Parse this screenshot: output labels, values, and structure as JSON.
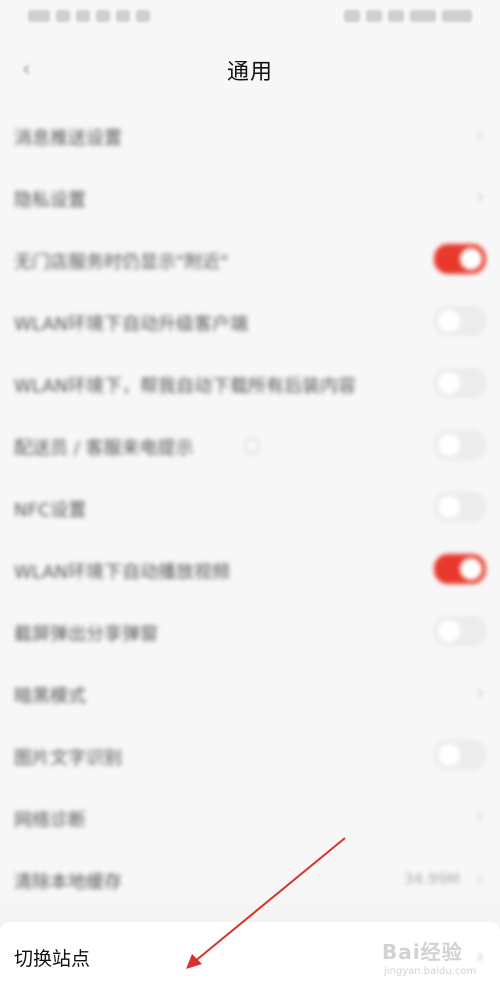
{
  "page_title": "通用",
  "status_bar": {},
  "settings": [
    {
      "label": "消息推送设置",
      "control": "chevron"
    },
    {
      "label": "隐私设置",
      "control": "chevron"
    },
    {
      "label": "无门店服务时仍显示\"附近\"",
      "control": "toggle",
      "on": true
    },
    {
      "label": "WLAN环境下自动升级客户端",
      "control": "toggle",
      "on": false
    },
    {
      "label": "WLAN环境下，帮我自动下载所有后装内容",
      "control": "toggle",
      "on": false
    },
    {
      "label": "配送员 / 客服来电提示",
      "control": "toggle",
      "on": false,
      "info_icon": true
    },
    {
      "label": "NFC设置",
      "control": "toggle",
      "on": false
    },
    {
      "label": "WLAN环境下自动播放视频",
      "control": "toggle",
      "on": true
    },
    {
      "label": "截屏弹出分享弹窗",
      "control": "toggle",
      "on": false
    },
    {
      "label": "暗黑模式",
      "control": "chevron"
    },
    {
      "label": "图片文字识别",
      "control": "toggle",
      "on": false
    },
    {
      "label": "网络诊断",
      "control": "chevron"
    },
    {
      "label": "清除本地缓存",
      "control": "value",
      "value": "34.99M"
    }
  ],
  "bottom_item": {
    "label": "切换站点"
  },
  "watermark": {
    "logo": "Bai经验",
    "url": "jingyan.baidu.com"
  },
  "colors": {
    "toggle_on": "#e8392c",
    "annotation_arrow": "#d9322a"
  },
  "icons": {
    "back": "back-arrow-icon",
    "chevron": "chevron-right-icon",
    "info": "info-circle-icon"
  }
}
